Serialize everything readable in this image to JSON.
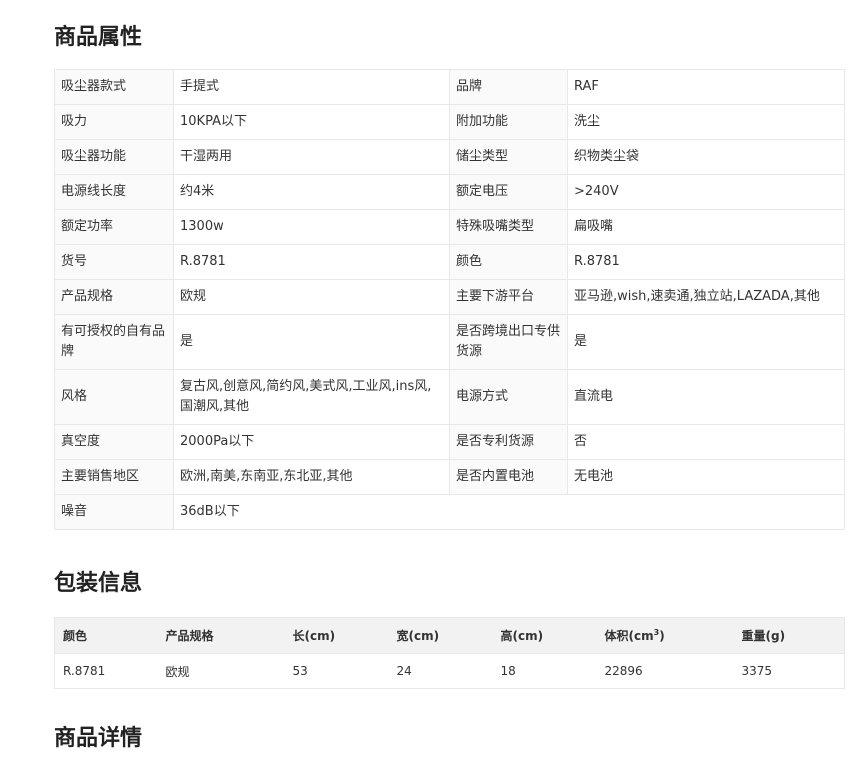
{
  "sections": {
    "attributes_title": "商品属性",
    "package_title": "包装信息",
    "details_title": "商品详情"
  },
  "attributes": [
    {
      "k1": "吸尘器款式",
      "v1": "手提式",
      "k2": "品牌",
      "v2": "RAF"
    },
    {
      "k1": "吸力",
      "v1": "10KPA以下",
      "k2": "附加功能",
      "v2": "洗尘"
    },
    {
      "k1": "吸尘器功能",
      "v1": "干湿两用",
      "k2": "储尘类型",
      "v2": "织物类尘袋"
    },
    {
      "k1": "电源线长度",
      "v1": "约4米",
      "k2": "额定电压",
      "v2": ">240V"
    },
    {
      "k1": "额定功率",
      "v1": "1300w",
      "k2": "特殊吸嘴类型",
      "v2": "扁吸嘴"
    },
    {
      "k1": "货号",
      "v1": "R.8781",
      "k2": "颜色",
      "v2": "R.8781"
    },
    {
      "k1": "产品规格",
      "v1": "欧规",
      "k2": "主要下游平台",
      "v2": "亚马逊,wish,速卖通,独立站,LAZADA,其他"
    },
    {
      "k1": "有可授权的自有品牌",
      "v1": "是",
      "k2": "是否跨境出口专供货源",
      "v2": "是"
    },
    {
      "k1": "风格",
      "v1": "复古风,创意风,简约风,美式风,工业风,ins风,国潮风,其他",
      "k2": "电源方式",
      "v2": "直流电"
    },
    {
      "k1": "真空度",
      "v1": "2000Pa以下",
      "k2": "是否专利货源",
      "v2": "否"
    },
    {
      "k1": "主要销售地区",
      "v1": "欧洲,南美,东南亚,东北亚,其他",
      "k2": "是否内置电池",
      "v2": "无电池"
    },
    {
      "k1": "噪音",
      "v1": "36dB以下"
    }
  ],
  "package": {
    "headers": {
      "color": "颜色",
      "spec": "产品规格",
      "length": "长(cm)",
      "width": "宽(cm)",
      "height": "高(cm)",
      "volume_prefix": "体积(cm",
      "volume_sup": "3",
      "volume_suffix": ")",
      "weight": "重量(g)"
    },
    "rows": [
      {
        "color": "R.8781",
        "spec": "欧规",
        "length": "53",
        "width": "24",
        "height": "18",
        "volume": "22896",
        "weight": "3375"
      }
    ]
  }
}
